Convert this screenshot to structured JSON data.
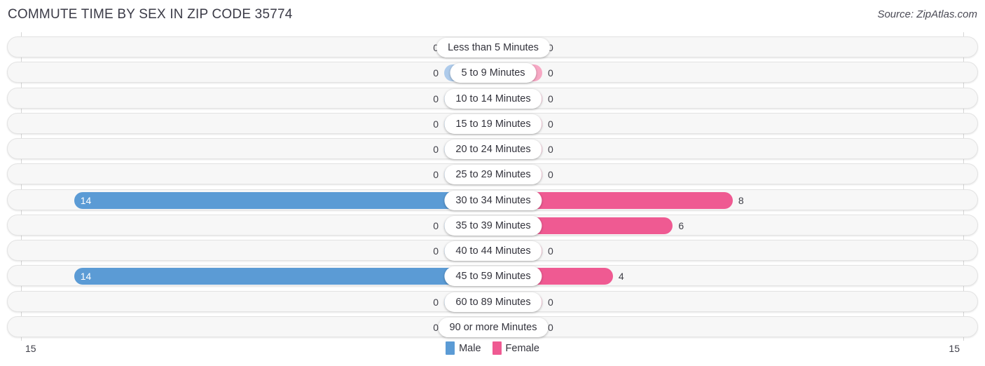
{
  "header": {
    "title": "COMMUTE TIME BY SEX IN ZIP CODE 35774",
    "source": "Source: ZipAtlas.com"
  },
  "legend": {
    "male_label": "Male",
    "female_label": "Female",
    "male_color": "#5b9bd5",
    "female_color": "#ef5a92"
  },
  "axis": {
    "left_max_label": "15",
    "right_max_label": "15"
  },
  "colors": {
    "male_active": "#5b9bd5",
    "male_zero": "#aecbeb",
    "female_active": "#ef5a92",
    "female_zero": "#f7a8c4",
    "track": "#f7f7f7",
    "track_border": "#e3e3e3"
  },
  "chart_data": {
    "type": "bar",
    "title": "COMMUTE TIME BY SEX IN ZIP CODE 35774",
    "subtitle": "",
    "orientation": "horizontal-diverging",
    "xlabel": "",
    "ylabel": "",
    "xlim": [
      15,
      15
    ],
    "grid": true,
    "legend_position": "bottom-center",
    "categories": [
      "Less than 5 Minutes",
      "5 to 9 Minutes",
      "10 to 14 Minutes",
      "15 to 19 Minutes",
      "20 to 24 Minutes",
      "25 to 29 Minutes",
      "30 to 34 Minutes",
      "35 to 39 Minutes",
      "40 to 44 Minutes",
      "45 to 59 Minutes",
      "60 to 89 Minutes",
      "90 or more Minutes"
    ],
    "series": [
      {
        "name": "Male",
        "color": "#5b9bd5",
        "values": [
          0,
          0,
          0,
          0,
          0,
          0,
          14,
          0,
          0,
          14,
          0,
          0
        ]
      },
      {
        "name": "Female",
        "color": "#ef5a92",
        "values": [
          0,
          0,
          0,
          0,
          0,
          0,
          8,
          6,
          0,
          4,
          0,
          0
        ]
      }
    ]
  }
}
